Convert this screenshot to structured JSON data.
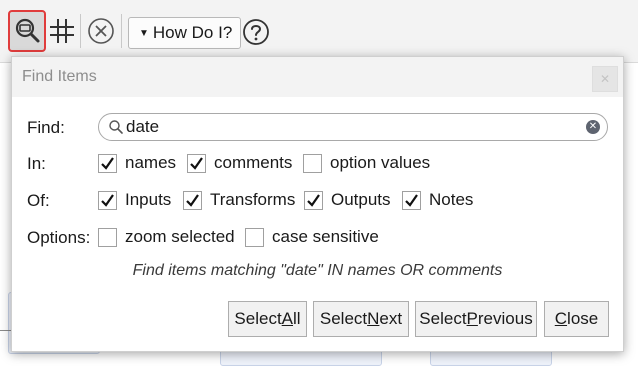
{
  "toolbar": {
    "find_icon": "find-items-icon",
    "grid_icon": "grid-icon",
    "clear_icon": "clear-selection-icon",
    "how_do_i_label": "How Do I?",
    "help_icon": "help-icon",
    "accent_highlight": "#e03c3c"
  },
  "dialog": {
    "title": "Find Items",
    "find": {
      "label": "Find:",
      "value": "date",
      "search_icon": "search-icon",
      "clear_icon": "clear-search-icon"
    },
    "in": {
      "label": "In:",
      "options": [
        {
          "label": "names",
          "checked": true
        },
        {
          "label": "comments",
          "checked": true
        },
        {
          "label": "option values",
          "checked": false
        }
      ]
    },
    "of": {
      "label": "Of:",
      "options": [
        {
          "label": "Inputs",
          "checked": true
        },
        {
          "label": "Transforms",
          "checked": true
        },
        {
          "label": "Outputs",
          "checked": true
        },
        {
          "label": "Notes",
          "checked": true
        }
      ]
    },
    "options": {
      "label": "Options:",
      "options": [
        {
          "label": "zoom selected",
          "checked": false
        },
        {
          "label": "case sensitive",
          "checked": false
        }
      ]
    },
    "status": "Find items matching \"date\" IN names OR comments",
    "buttons": {
      "select_all": {
        "pre": "Select ",
        "mnemonic": "A",
        "post": "ll"
      },
      "select_next": {
        "pre": "Select ",
        "mnemonic": "N",
        "post": "ext"
      },
      "select_previous": {
        "pre": "Select ",
        "mnemonic": "P",
        "post": "revious"
      },
      "close": {
        "pre": "",
        "mnemonic": "C",
        "post": "lose"
      }
    }
  }
}
